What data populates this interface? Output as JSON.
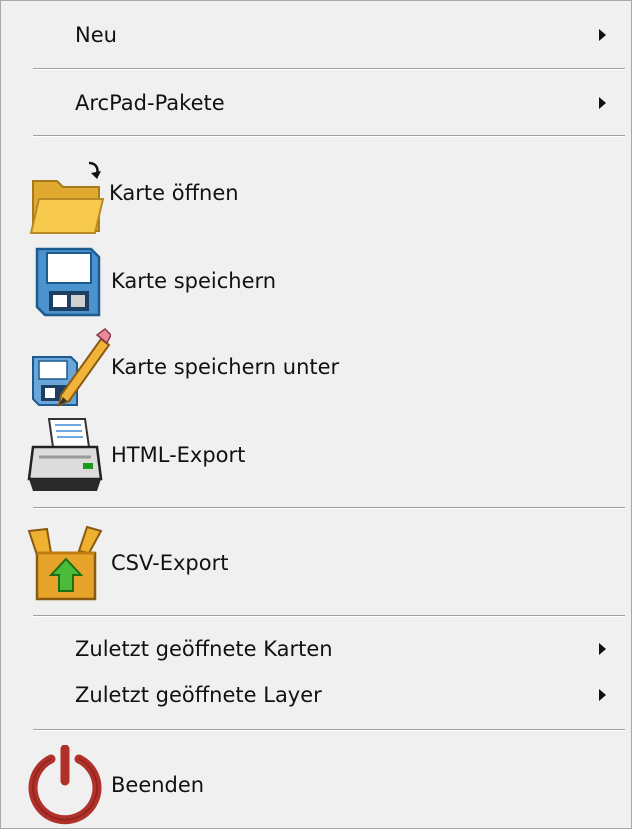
{
  "menu": {
    "new": {
      "label": "Neu",
      "icon": "submenu-arrow"
    },
    "arcpad_packages": {
      "label": "ArcPad-Pakete",
      "icon": "submenu-arrow"
    },
    "open_map": {
      "label": "Karte öffnen",
      "icon": "open-folder-icon"
    },
    "save_map": {
      "label": "Karte speichern",
      "icon": "floppy-disk-icon"
    },
    "save_map_as": {
      "label": "Karte speichern unter",
      "icon": "floppy-pencil-icon"
    },
    "html_export": {
      "label": "HTML-Export",
      "icon": "printer-icon"
    },
    "csv_export": {
      "label": "CSV-Export",
      "icon": "box-export-icon"
    },
    "recent_maps": {
      "label": "Zuletzt geöffnete Karten",
      "icon": "submenu-arrow"
    },
    "recent_layers": {
      "label": "Zuletzt geöffnete Layer",
      "icon": "submenu-arrow"
    },
    "exit": {
      "label": "Beenden",
      "icon": "power-icon"
    }
  },
  "colors": {
    "menu_bg": "#f0f0f0",
    "folder": "#f5c242",
    "floppy": "#2f7fc0",
    "power": "#b03028",
    "box": "#e8a92a",
    "arrow_green": "#3aa83a"
  }
}
